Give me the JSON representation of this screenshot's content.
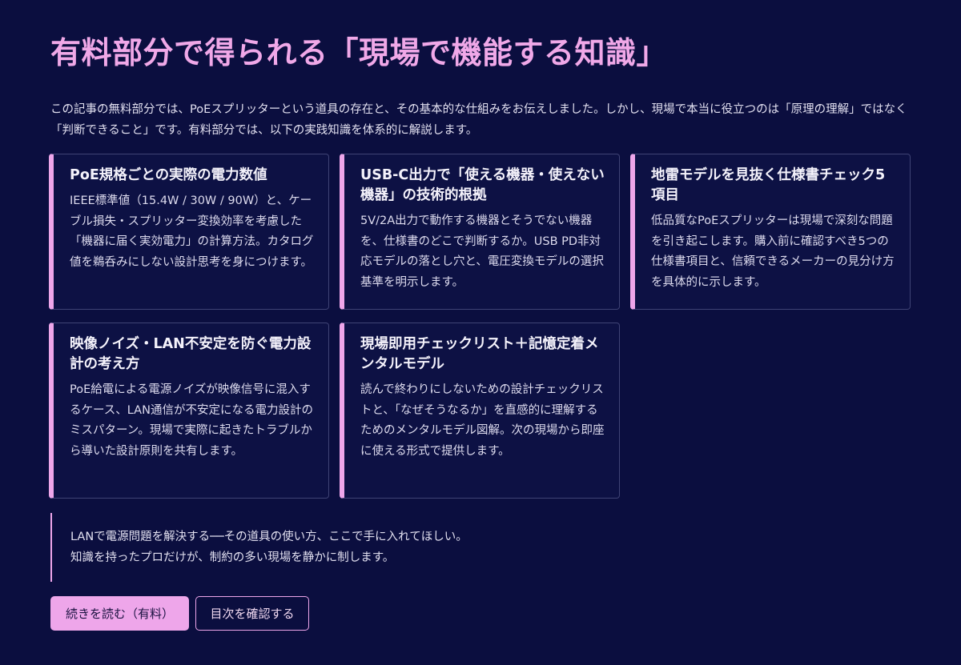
{
  "heading": "有料部分で得られる「現場で機能する知識」",
  "intro": "この記事の無料部分では、PoEスプリッターという道具の存在と、その基本的な仕組みをお伝えしました。しかし、現場で本当に役立つのは「原理の理解」ではなく「判断できること」です。有料部分では、以下の実践知識を体系的に解説します。",
  "cards": [
    {
      "title": "PoE規格ごとの実際の電力数値",
      "body": "IEEE標準値（15.4W / 30W / 90W）と、ケーブル損失・スプリッター変換効率を考慮した「機器に届く実効電力」の計算方法。カタログ値を鵜呑みにしない設計思考を身につけます。"
    },
    {
      "title": "USB-C出力で「使える機器・使えない機器」の技術的根拠",
      "body": "5V/2A出力で動作する機器とそうでない機器を、仕様書のどこで判断するか。USB PD非対応モデルの落とし穴と、電圧変換モデルの選択基準を明示します。"
    },
    {
      "title": "地雷モデルを見抜く仕様書チェック5項目",
      "body": "低品質なPoEスプリッターは現場で深刻な問題を引き起こします。購入前に確認すべき5つの仕様書項目と、信頼できるメーカーの見分け方を具体的に示します。"
    },
    {
      "title": "映像ノイズ・LAN不安定を防ぐ電力設計の考え方",
      "body": "PoE給電による電源ノイズが映像信号に混入するケース、LAN通信が不安定になる電力設計のミスパターン。現場で実際に起きたトラブルから導いた設計原則を共有します。"
    },
    {
      "title": "現場即用チェックリスト＋記憶定着メンタルモデル",
      "body": "読んで終わりにしないための設計チェックリストと、「なぜそうなるか」を直感的に理解するためのメンタルモデル図解。次の現場から即座に使える形式で提供します。"
    }
  ],
  "quote": {
    "line1": "LANで電源問題を解決する──その道具の使い方、ここで手に入れてほしい。",
    "line2": "知識を持ったプロだけが、制約の多い現場を静かに制します。"
  },
  "buttons": {
    "primary": "続きを読む（有料）",
    "secondary": "目次を確認する"
  },
  "colors": {
    "background": "#0b0e3f",
    "accent": "#eea6ea",
    "card_border": "#3f4375"
  }
}
